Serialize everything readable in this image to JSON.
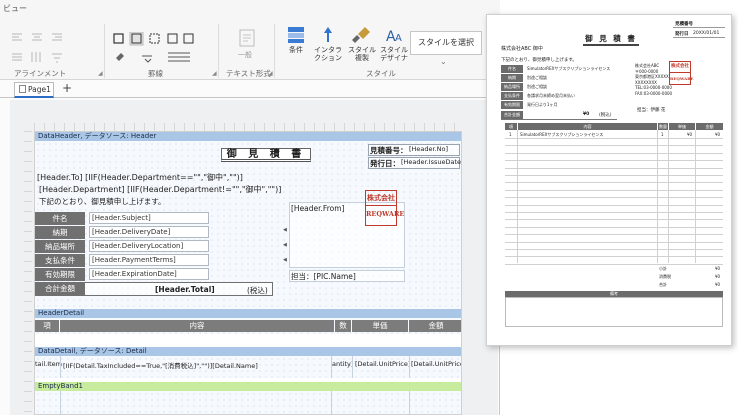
{
  "ribbon": {
    "title": "ビュー",
    "groups": {
      "alignment": "アラインメント",
      "border": "罫線",
      "text_format": "テキスト形式",
      "style": "スタイル"
    },
    "small_label": "一般",
    "buttons": {
      "condition": "条件",
      "interaction": [
        "インタラ",
        "クション"
      ],
      "style_copy": [
        "スタイル",
        "複製"
      ],
      "style_designer": [
        "スタイル",
        "デザイナ"
      ]
    },
    "select_style": "スタイルを選択"
  },
  "tabs": {
    "page": "Page1",
    "add": "+"
  },
  "report": {
    "data_header_band": "DataHeader, データソース: Header",
    "title": "御 見 積 書",
    "estimate_no_label": "見積番号：",
    "estimate_no_field": "[Header.No]",
    "issue_date_label": "発行日：",
    "issue_date_field": "[Header.IssueDate]",
    "to_line": "[Header.To] [IIF(Header.Department==\"\",\"御中\",\"\")]",
    "dept_line": "[Header.Department] [IIF(Header.Department!=\"\",\"御中\",\"\")]",
    "intro": "下記のとおり、御見積申し上げます。",
    "from_field": "[Header.From]",
    "stamp": [
      "株式会社",
      "REQWARE"
    ],
    "pic_field": "担当：[PIC.Name]",
    "rows": [
      {
        "label": "件名",
        "field": "[Header.Subject]"
      },
      {
        "label": "納期",
        "field": "[Header.DeliveryDate]"
      },
      {
        "label": "納品場所",
        "field": "[Header.DeliveryLocation]"
      },
      {
        "label": "支払条件",
        "field": "[Header.PaymentTerms]"
      },
      {
        "label": "有効期限",
        "field": "[Header.ExpirationDate]"
      }
    ],
    "total_label": "合計金額",
    "total_field": "[Header.Total]",
    "tax_note": "(税込)",
    "header_detail_band": "HeaderDetail",
    "detail_cols": [
      "項",
      "内容",
      "数",
      "単価",
      "金額"
    ],
    "data_detail_band": "DataDetail, データソース: Detail",
    "detail_fields": [
      "tail.Item",
      "[IIF(Detail.TaxIncluded==True,\"[消費税込]\",\"\")][Detail.Name]",
      "antity]",
      "[Detail.UnitPrice]",
      "[Detail.UnitPrice]"
    ],
    "empty_band": "EmptyBand1"
  },
  "preview": {
    "title": "御 見 積 書",
    "meta_labels": [
      "見積番号",
      "発行日"
    ],
    "meta_values": [
      "",
      "20XX/01/01"
    ],
    "to": "株式会社ABC 御中",
    "intro": "下記のとおり、御見積申し上げます。",
    "rows": [
      {
        "label": "件名",
        "value": "SimulatorREXサブスクリプションライセンス"
      },
      {
        "label": "納期",
        "value": "別途ご相談"
      },
      {
        "label": "納品場所",
        "value": "別途ご相談"
      },
      {
        "label": "支払条件",
        "value": "各請求月末締め翌月末払い"
      },
      {
        "label": "有効期限",
        "value": "発行日より1ヶ月"
      }
    ],
    "from_lines": [
      "株式会社ABC",
      "〒000-0000",
      "東京都港区XXXXX",
      "XXXXXXXX",
      "TEL:03-0000-0000",
      "FAX:03-0000-0000"
    ],
    "stamp": [
      "株式会社",
      "REQWARE"
    ],
    "pic": "担当：伊藤 花",
    "total_label": "合計金額",
    "total_value": "¥0",
    "tax_note": "(税込)",
    "table_headers": [
      "項",
      "内容",
      "数量",
      "単価",
      "金額"
    ],
    "first_item": {
      "no": "1",
      "name": "SimulatorREXサブスクリプションライセンス",
      "qty": "1",
      "price": "¥0",
      "amount": "¥0"
    },
    "summary": [
      {
        "label": "小計",
        "value": "¥0"
      },
      {
        "label": "消費税",
        "value": "¥0"
      },
      {
        "label": "合計",
        "value": "¥0"
      }
    ],
    "remarks_label": "備考"
  }
}
